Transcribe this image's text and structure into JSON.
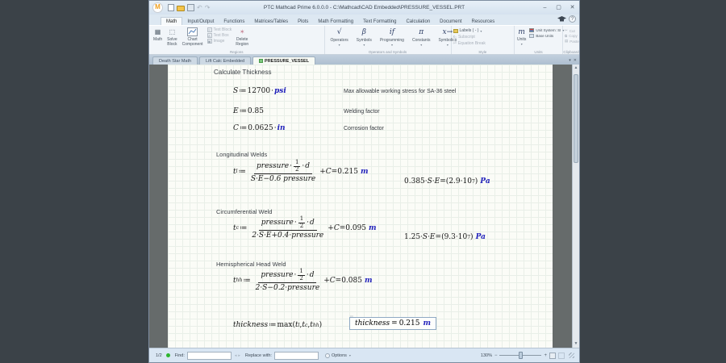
{
  "window": {
    "title": "PTC Mathcad Prime 6.0.0.0 - C:\\Mathcad\\CAD Embedded\\PRESSURE_VESSEL.PRT",
    "logo_letter": "M",
    "minimize": "–",
    "maximize": "▢",
    "close": "✕"
  },
  "ribbon_tabs": {
    "math": "Math",
    "input_output": "Input/Output",
    "functions": "Functions",
    "matrices": "Matrices/Tables",
    "plots": "Plots",
    "math_formatting": "Math Formatting",
    "text_formatting": "Text Formatting",
    "calculation": "Calculation",
    "document": "Document",
    "resources": "Resources"
  },
  "ribbon": {
    "regions": {
      "group": "Regions",
      "math": "Math",
      "solve": "Solve\nBlock",
      "chart": "Chart\nComponent",
      "text_block": "Text Block",
      "text_box": "Text Box",
      "image": "Image",
      "delete": "Delete\nRegion"
    },
    "ops": {
      "group": "Operators and Symbols",
      "operators_icon": "√",
      "operators": "Operators",
      "symbols_icon": "β",
      "symbols": "Symbols",
      "programming_icon": "if",
      "programming": "Programming",
      "constants_icon": "π",
      "constants": "Constants",
      "symbolics_icon": "x→",
      "symbolics": "Symbolics",
      "caret": "▾"
    },
    "style": {
      "group": "Style",
      "labels": "Labels ( - )",
      "subscript": "Subscript",
      "eq_break": "Equation Break"
    },
    "units": {
      "group": "Units",
      "m_icon": "m",
      "units": "Units",
      "system": "Unit System: SI",
      "base": "Base Units"
    },
    "clipboard": {
      "group": "Clipboard",
      "cut": "Cut",
      "copy": "Copy",
      "paste": "Paste"
    }
  },
  "doc_tabs": {
    "tab1": "Death Star Math",
    "tab2": "Lift Calc Embedded",
    "tab3": "PRESSURE_VESSEL"
  },
  "sheet": {
    "heading": "Calculate Thickness",
    "defs": [
      {
        "var": "S",
        "assign": "≔",
        "value": "12700",
        "dot": "·",
        "unit": "psi",
        "note": "Max allowable working stress for SA-36 steel"
      },
      {
        "var": "E",
        "assign": "≔",
        "value": "0.85",
        "dot": "",
        "unit": "",
        "note": "Welding factor"
      },
      {
        "var": "C",
        "assign": "≔",
        "value": "0.0625",
        "dot": "·",
        "unit": "in",
        "note": "Corrosion factor"
      }
    ],
    "sections": [
      {
        "heading": "Longitudinal Welds",
        "var": "t",
        "sub": "l",
        "assign": "≔",
        "num_left": "pressure",
        "dot": "·",
        "half_top": "1",
        "half_bot": "2",
        "num_right": "d",
        "den": "S·E−0.6 pressure",
        "plus": "+",
        "cvar": "C",
        "eq": "=",
        "result": "0.215",
        "unit": "m",
        "side_coef": "0.385·",
        "side_vars": "S·E",
        "side_eq": "=",
        "side_open": "(",
        "side_mant": "2.9·10",
        "side_exp": "7",
        "side_close": ")",
        "side_unit": "Pa"
      },
      {
        "heading": "Circumferential Weld",
        "var": "t",
        "sub": "c",
        "assign": "≔",
        "num_left": "pressure",
        "dot": "·",
        "half_top": "1",
        "half_bot": "2",
        "num_right": "d",
        "den": "2·S·E+0.4·pressure",
        "plus": "+",
        "cvar": "C",
        "eq": "=",
        "result": "0.095",
        "unit": "m",
        "side_coef": "1.25·",
        "side_vars": "S·E",
        "side_eq": "=",
        "side_open": "(",
        "side_mant": "9.3·10",
        "side_exp": "7",
        "side_close": ")",
        "side_unit": "Pa"
      },
      {
        "heading": "Hemispherical Head Weld",
        "var": "t",
        "sub": "hh",
        "assign": "≔",
        "num_left": "pressure",
        "dot": "·",
        "half_top": "1",
        "half_bot": "2",
        "num_right": "d",
        "den": "2·S−0.2·pressure",
        "plus": "+",
        "cvar": "C",
        "eq": "=",
        "result": "0.085",
        "unit": "m"
      }
    ],
    "final": {
      "var": "thickness",
      "assign": "≔",
      "func": "max",
      "open": "(",
      "a1v": "t",
      "a1s": "l",
      "c1": ", ",
      "a2v": "t",
      "a2s": "c",
      "c2": ", ",
      "a3v": "t",
      "a3s": "hh",
      "close": ")",
      "boxed_var": "thickness",
      "boxed_eq": "=",
      "boxed_val": "0.215",
      "boxed_unit": "m"
    }
  },
  "statusbar": {
    "pages": "1/2",
    "find_label": "Find:",
    "replace_label": "Replace with:",
    "options": "Options",
    "options_caret": "▾",
    "zoom": "130%",
    "zoom_minus": "−",
    "zoom_plus": "+"
  },
  "colors": {
    "unit_blue": "#2323bb",
    "accent_orange": "#f0a01e",
    "status_green": "#2eb52e"
  }
}
